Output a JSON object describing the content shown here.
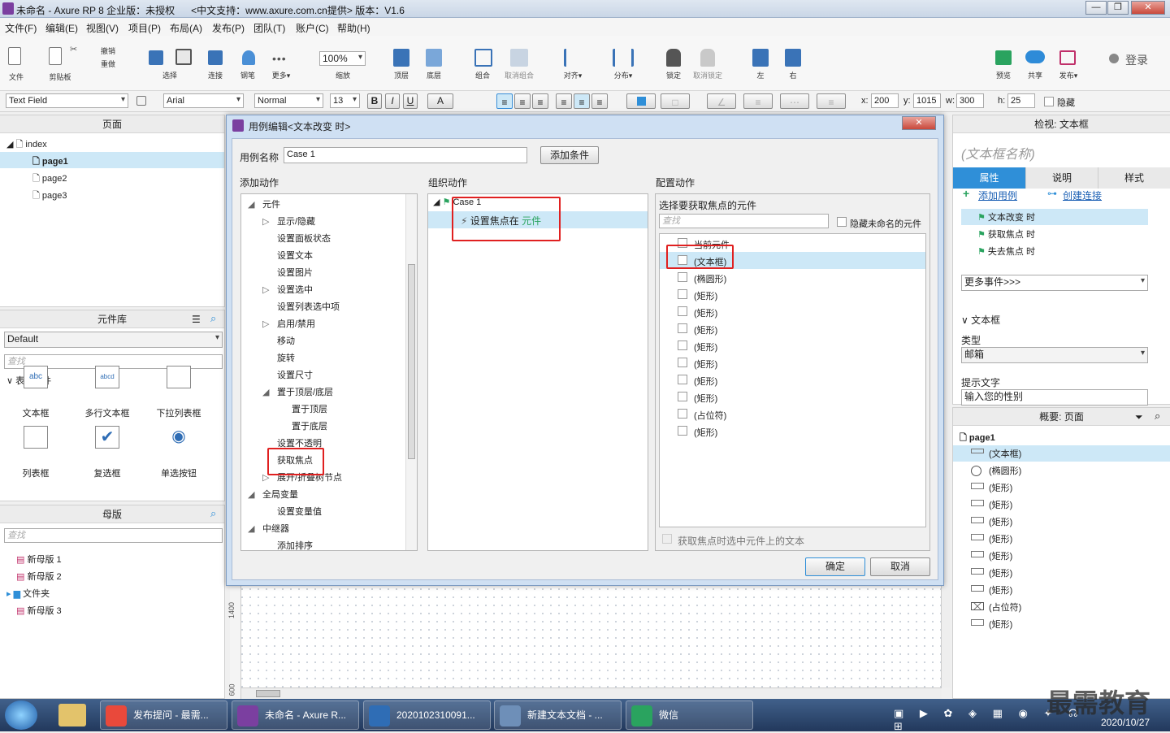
{
  "titlebar": {
    "title": "未命名 - Axure RP 8 企业版：未授权      <中文支持：www.axure.com.cn提供> 版本：V1.6"
  },
  "menu": [
    "文件(F)",
    "编辑(E)",
    "视图(V)",
    "项目(P)",
    "布局(A)",
    "发布(P)",
    "团队(T)",
    "账户(C)",
    "帮助(H)"
  ],
  "toolbar": {
    "file": "文件",
    "clipboard": "剪贴板",
    "undo": "撤销",
    "redo": "重做",
    "select": "选择",
    "connect": "连接",
    "pen": "钢笔",
    "more": "更多▾",
    "zoom": "100%",
    "zoom_label": "缩放",
    "top": "顶层",
    "bottom": "底层",
    "group": "组合",
    "ungroup": "取消组合",
    "align": "对齐▾",
    "distribute": "分布▾",
    "lock": "锁定",
    "unlock": "取消锁定",
    "left": "左",
    "right": "右",
    "preview": "预览",
    "share": "共享",
    "publish": "发布▾",
    "login": "登录"
  },
  "format": {
    "widget_type": "Text Field",
    "font": "Arial",
    "style": "Normal",
    "size": "13",
    "bold": "B",
    "italic": "I",
    "underline": "U",
    "text_color": "A",
    "x_label": "x:",
    "x": "200",
    "y_label": "y:",
    "y": "1015",
    "w_label": "w:",
    "w": "300",
    "h_label": "h:",
    "h": "25",
    "hidden": "隐藏"
  },
  "pages": {
    "title": "页面",
    "root": "index",
    "items": [
      "page1",
      "page2",
      "page3"
    ]
  },
  "library": {
    "title": "元件库",
    "selected": "Default",
    "search_placeholder": "查找",
    "section": "表单元件",
    "widgets": [
      "文本框",
      "多行文本框",
      "下拉列表框",
      "列表框",
      "复选框",
      "单选按钮"
    ],
    "abc": "abc",
    "abcd": "abcd"
  },
  "masters": {
    "title": "母版",
    "search_placeholder": "查找",
    "items": [
      "新母版 1",
      "新母版 2",
      "文件夹",
      "新母版 3"
    ]
  },
  "dialog": {
    "title": "用例编辑<文本改变 时>",
    "case_name_label": "用例名称",
    "case_name": "Case 1",
    "add_condition": "添加条件",
    "add_action": "添加动作",
    "organize_action": "组织动作",
    "configure_action": "配置动作",
    "actions": [
      {
        "t": "元件",
        "lvl": 0,
        "exp": "open"
      },
      {
        "t": "显示/隐藏",
        "lvl": 1,
        "exp": "closed"
      },
      {
        "t": "设置面板状态",
        "lvl": 1
      },
      {
        "t": "设置文本",
        "lvl": 1
      },
      {
        "t": "设置图片",
        "lvl": 1
      },
      {
        "t": "设置选中",
        "lvl": 1,
        "exp": "closed"
      },
      {
        "t": "设置列表选中项",
        "lvl": 1
      },
      {
        "t": "启用/禁用",
        "lvl": 1,
        "exp": "closed"
      },
      {
        "t": "移动",
        "lvl": 1
      },
      {
        "t": "旋转",
        "lvl": 1
      },
      {
        "t": "设置尺寸",
        "lvl": 1
      },
      {
        "t": "置于顶层/底层",
        "lvl": 1,
        "exp": "open"
      },
      {
        "t": "置于顶层",
        "lvl": 2
      },
      {
        "t": "置于底层",
        "lvl": 2
      },
      {
        "t": "设置不透明",
        "lvl": 1
      },
      {
        "t": "获取焦点",
        "lvl": 1
      },
      {
        "t": "展开/折叠树节点",
        "lvl": 1,
        "exp": "closed"
      },
      {
        "t": "全局变量",
        "lvl": 0,
        "exp": "open"
      },
      {
        "t": "设置变量值",
        "lvl": 1
      },
      {
        "t": "中继器",
        "lvl": 0,
        "exp": "open"
      },
      {
        "t": "添加排序",
        "lvl": 1
      }
    ],
    "case_node": "Case 1",
    "action_prefix": "设置焦点在 ",
    "action_target": "元件",
    "config_title": "选择要获取焦点的元件",
    "config_search_placeholder": "查找",
    "hide_unnamed": "隐藏未命名的元件",
    "elements": [
      "当前元件",
      "(文本框)",
      "(椭圆形)",
      "(矩形)",
      "(矩形)",
      "(矩形)",
      "(矩形)",
      "(矩形)",
      "(矩形)",
      "(矩形)",
      "(占位符)",
      "(矩形)"
    ],
    "select_text_option": "获取焦点时选中元件上的文本",
    "ok": "确定",
    "cancel": "取消"
  },
  "inspector": {
    "title": "检视: 文本框",
    "name_placeholder": "(文本框名称)",
    "tabs": [
      "属性",
      "说明",
      "样式"
    ],
    "add_case": "添加用例",
    "create_link": "创建连接",
    "events": [
      "文本改变 时",
      "获取焦点 时",
      "失去焦点 时"
    ],
    "more_events": "更多事件>>>",
    "section": "文本框",
    "type_label": "类型",
    "type_value": "邮箱",
    "hint_label": "提示文字",
    "hint_value": "输入您的性别"
  },
  "outline": {
    "title": "概要: 页面",
    "page": "page1",
    "items": [
      {
        "icon": "textbox-icon",
        "t": "(文本框)"
      },
      {
        "icon": "ellipse-icon",
        "t": "(椭圆形)"
      },
      {
        "icon": "rect-icon",
        "t": "(矩形)"
      },
      {
        "icon": "rect-icon",
        "t": "(矩形)"
      },
      {
        "icon": "rect-icon",
        "t": "(矩形)"
      },
      {
        "icon": "rect-icon",
        "t": "(矩形)"
      },
      {
        "icon": "rect-icon",
        "t": "(矩形)"
      },
      {
        "icon": "rect-icon",
        "t": "(矩形)"
      },
      {
        "icon": "rect-icon",
        "t": "(矩形)"
      },
      {
        "icon": "placeholder-icon",
        "t": "(占位符)"
      },
      {
        "icon": "rect-icon",
        "t": "(矩形)"
      }
    ]
  },
  "canvas": {
    "ruler_1400": "1400",
    "ruler_600": "600"
  },
  "taskbar": {
    "items": [
      "发布提问 - 最需...",
      "未命名 - Axure R...",
      "202010231009​1...",
      "新建文本文档 - ...",
      "微信"
    ],
    "time": "2020/10/27",
    "watermark": "最需教育"
  },
  "colors": {
    "accent": "#2f8fd8",
    "red": "#e02020",
    "selection": "#cde8f7"
  }
}
